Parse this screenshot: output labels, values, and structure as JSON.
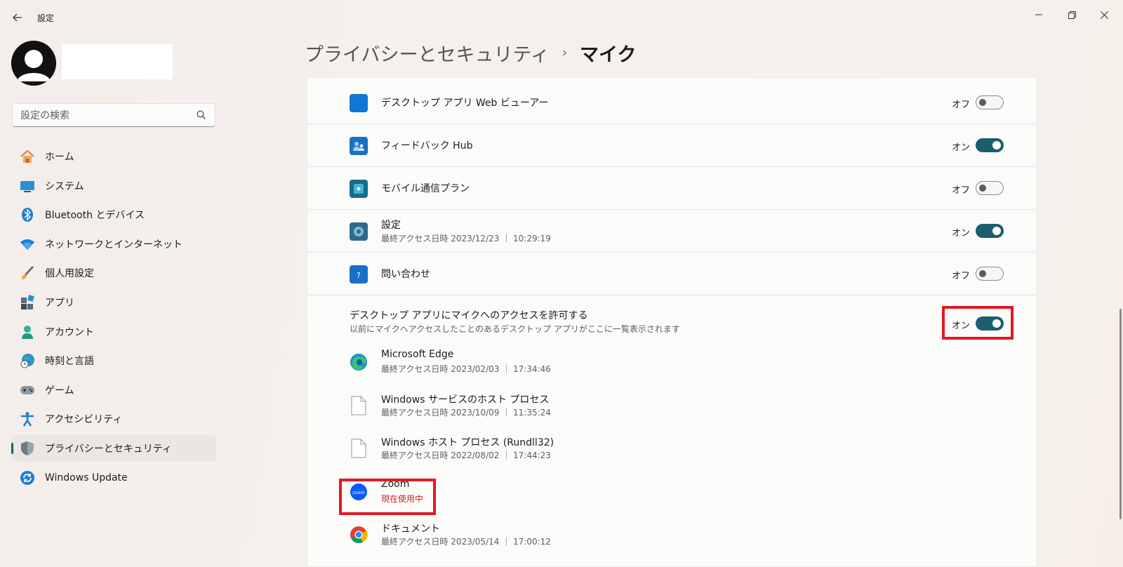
{
  "window": {
    "title": "設定"
  },
  "search": {
    "placeholder": "設定の検索"
  },
  "nav": [
    {
      "label": "ホーム",
      "icon": "home-icon"
    },
    {
      "label": "システム",
      "icon": "monitor-icon"
    },
    {
      "label": "Bluetooth とデバイス",
      "icon": "bluetooth-icon"
    },
    {
      "label": "ネットワークとインターネット",
      "icon": "wifi-icon"
    },
    {
      "label": "個人用設定",
      "icon": "brush-icon"
    },
    {
      "label": "アプリ",
      "icon": "apps-icon"
    },
    {
      "label": "アカウント",
      "icon": "person-icon"
    },
    {
      "label": "時刻と言語",
      "icon": "globe-clock-icon"
    },
    {
      "label": "ゲーム",
      "icon": "gamepad-icon"
    },
    {
      "label": "アクセシビリティ",
      "icon": "accessibility-icon"
    },
    {
      "label": "プライバシーとセキュリティ",
      "icon": "shield-icon",
      "active": true
    },
    {
      "label": "Windows Update",
      "icon": "update-icon"
    }
  ],
  "breadcrumb": {
    "parent": "プライバシーとセキュリティ",
    "separator": "›",
    "current": "マイク"
  },
  "apps": [
    {
      "name": "デスクトップ アプリ Web ビューアー",
      "state": "オフ",
      "on": false
    },
    {
      "name": "フィードバック Hub",
      "state": "オン",
      "on": true
    },
    {
      "name": "モバイル通信プラン",
      "state": "オフ",
      "on": false
    },
    {
      "name": "設定",
      "sub": "最終アクセス日時 2023/12/23 ｜ 10:29:19",
      "state": "オン",
      "on": true
    },
    {
      "name": "問い合わせ",
      "state": "オフ",
      "on": false
    }
  ],
  "desktop_section": {
    "title": "デスクトップ アプリにマイクへのアクセスを許可する",
    "description": "以前にマイクへアクセスしたことのあるデスクトップ アプリがここに一覧表示されます",
    "state": "オン",
    "on": true
  },
  "desktop_apps": [
    {
      "name": "Microsoft Edge",
      "sub": "最終アクセス日時 2023/02/03 ｜ 17:34:46"
    },
    {
      "name": "Windows サービスのホスト プロセス",
      "sub": "最終アクセス日時 2023/10/09 ｜ 11:35:24"
    },
    {
      "name": "Windows ホスト プロセス (Rundll32)",
      "sub": "最終アクセス日時 2022/08/02 ｜ 17:44:23"
    },
    {
      "name": "Zoom",
      "sub": "現在使用中"
    },
    {
      "name": "ドキュメント",
      "sub": "最終アクセス日時 2023/05/14 ｜ 17:00:12"
    }
  ],
  "colors": {
    "accent": "#1b5e6d",
    "highlight": "#e11a23",
    "in_use": "#c42b1c"
  }
}
